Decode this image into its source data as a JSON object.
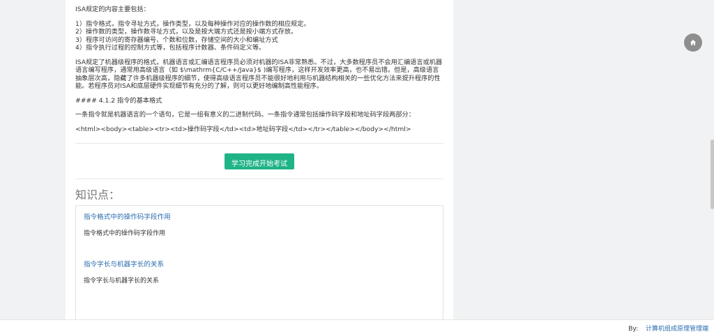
{
  "article": {
    "isa_intro": "ISA规定的内容主要包括：",
    "isa_items": [
      "1）指令格式，指令寻址方式，操作类型，以及每种操作对应的操作数的相应规定。",
      "2）操作数的类型，操作数寻址方式，以及是按大端方式还是按小端方式存放。",
      "3）程序可访问的寄存器编号、个数和位数，存储空间的大小和编址方式",
      "4）指令执行过程的控制方式等，包括程序计数器、条件码定义等。"
    ],
    "isa_paragraph": "ISA规定了机器级程序的格式，机器语言或汇编语言程序员必须对机器的ISA非常熟悉。不过，大多数程序员不会用汇编语言或机器语言编写程序，通常用高级语言（如 $\\mathrm{C/C++/Java}$ )编写程序，这样开发效率更高，也不易出错。但是，高级语言抽象层次高，隐藏了许多机器级程序的细节，使得高级语言程序员不能很好地利用与机器结构相关的一些优化方法来提升程序的性能。若程序员对ISA和底层硬件实现细节有充分的了解，则可以更好地编制高性能程序。",
    "section_heading": "#### 4.1.2 指令的基本格式",
    "section_paragraph": "一条指令就是机器语言的一个语句，它是一组有意义的二进制代码。一条指令通常包括操作码字段和地址码字段两部分：",
    "html_snippet": "<html><body><table><tr><td>操作码字段</td><td>地址码字段</td></tr></table></body></html>"
  },
  "actions": {
    "start_exam_label": "学习完成开始考试"
  },
  "knowledge": {
    "title": "知识点：",
    "items": [
      {
        "link": "指令格式中的操作码字段作用",
        "desc": "指令格式中的操作码字段作用"
      },
      {
        "link": "指令字长与机器字长的关系",
        "desc": "指令字长与机器字长的关系"
      }
    ]
  },
  "footer": {
    "by_label": "By:",
    "link_text": "计算机组成原理管理端"
  },
  "icons": {
    "home": "home-icon"
  },
  "colors": {
    "accent_button": "#1fb386",
    "link": "#2b6cb0",
    "home_button": "#8e8e8e"
  }
}
